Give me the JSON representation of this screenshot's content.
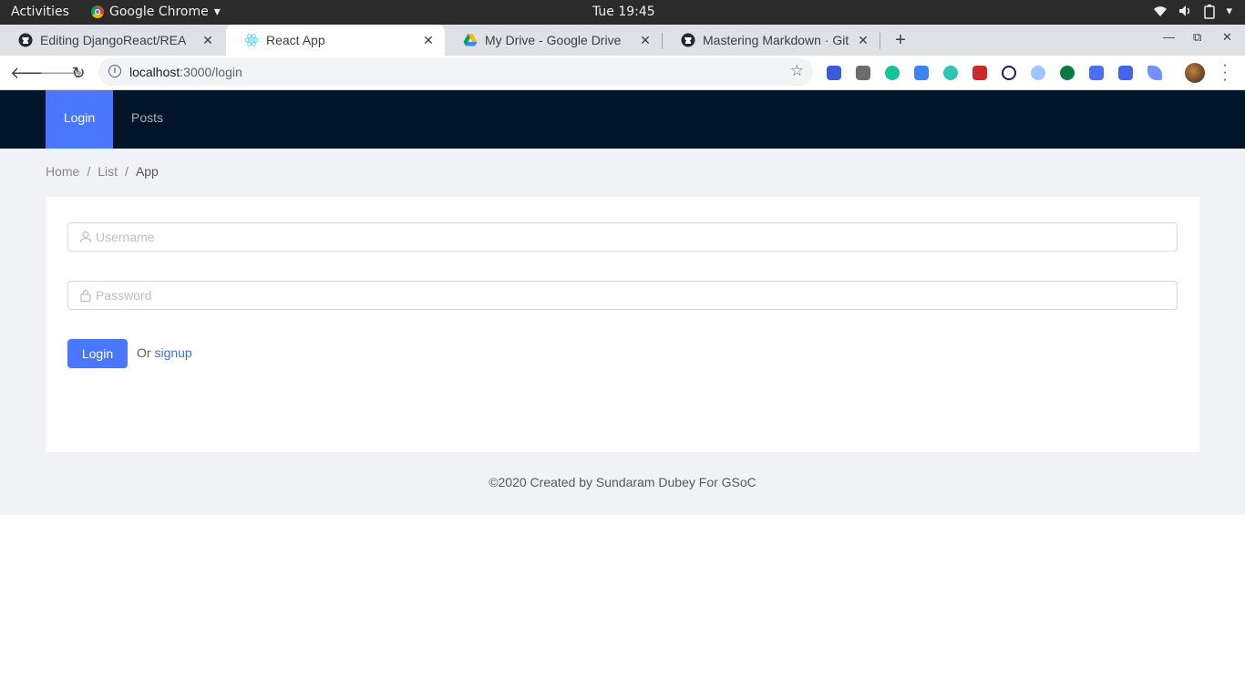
{
  "os_bar": {
    "activities": "Activities",
    "app_name": "Google Chrome",
    "clock": "Tue 19:45"
  },
  "browser": {
    "tabs": [
      {
        "title": "Editing DjangoReact/REA",
        "icon": "github-icon",
        "active": false
      },
      {
        "title": "React App",
        "icon": "react-icon",
        "active": true
      },
      {
        "title": "My Drive - Google Drive",
        "icon": "google-drive-icon",
        "active": false
      },
      {
        "title": "Mastering Markdown · Git",
        "icon": "github-icon",
        "active": false
      }
    ],
    "url_host": "localhost",
    "url_path": ":3000/login"
  },
  "app": {
    "nav": [
      {
        "label": "Login",
        "selected": true
      },
      {
        "label": "Posts",
        "selected": false
      }
    ],
    "breadcrumb": [
      "Home",
      "List",
      "App"
    ],
    "form": {
      "username_placeholder": "Username",
      "password_placeholder": "Password",
      "login_button": "Login",
      "or_text": "Or",
      "signup_link": "signup"
    },
    "footer": "©2020 Created by Sundaram Dubey For GSoC"
  },
  "colors": {
    "header_bg": "#001529",
    "primary": "#4a77ff",
    "layout_bg": "#f0f2f5"
  }
}
